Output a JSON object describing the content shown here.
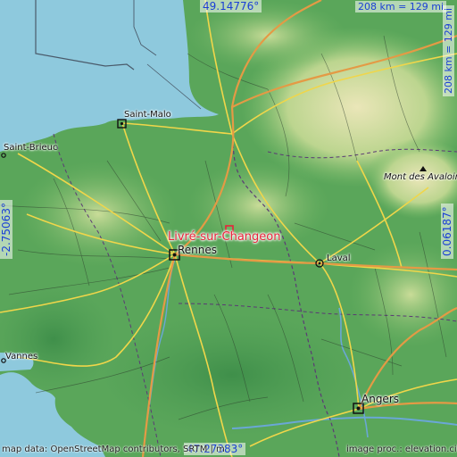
{
  "place": {
    "name": "Livré-sur-Changeon"
  },
  "coordinates": {
    "north": "49.14776°",
    "south": "47.27383°",
    "west": "-2.75063°",
    "east": "0.06187°"
  },
  "scale": {
    "horizontal": "208 km = 129 mi",
    "vertical": "208 km = 129 mi"
  },
  "cities": {
    "saint_malo": "Saint-Malo",
    "saint_brieuc": "Saint-Brieuc",
    "rennes": "Rennes",
    "laval": "Laval",
    "vannes": "Vannes",
    "angers": "Angers",
    "mont_des_avaloirs": "Mont des Avaloirs"
  },
  "credits": {
    "left": "map data: OpenStreetMap contributors, SRTM | map style: OpenTopoMap",
    "right": "image proc.: elevation.city"
  },
  "colors": {
    "sea": "#8ec9dd",
    "lowland": "#5aa65a",
    "highland": "#e4dfaa",
    "major_road": "#f0d64a",
    "motorway": "#e49a45",
    "place_marker": "#e8233a",
    "coordinate_text": "#1a3fd6"
  }
}
